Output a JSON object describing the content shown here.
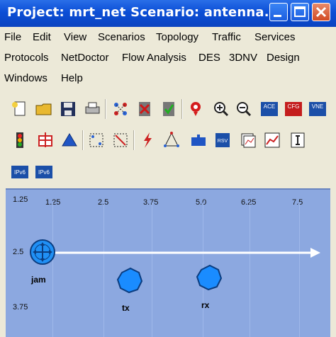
{
  "window": {
    "title": "Project: mrt_net Scenario: antenna..."
  },
  "menu": {
    "row1": [
      "File",
      "Edit",
      "View",
      "Scenarios",
      "Topology",
      "Traffic",
      "Services"
    ],
    "row2": [
      "Protocols",
      "NetDoctor",
      "Flow Analysis",
      "DES",
      "3DNV",
      "Design"
    ],
    "row3": [
      "Windows",
      "Help"
    ]
  },
  "toolbar": {
    "row1_icons": [
      "new-icon",
      "open-icon",
      "save-icon",
      "print-icon",
      "select-nodes-icon",
      "fail-icon",
      "recover-icon",
      "marker-icon",
      "zoom-in-icon",
      "zoom-out-icon",
      "ace-icon",
      "cfg-icon",
      "vne-icon"
    ],
    "row1_labels": {
      "ace": "ACE",
      "cfg": "CFG",
      "vne": "VNE"
    },
    "row2_icons": [
      "traffic-light-icon",
      "configure-icon",
      "triangle-icon",
      "grid-select-icon",
      "select-links-icon",
      "lightning-icon",
      "graph-icon",
      "puzzle-icon",
      "rsv-icon",
      "results-icon",
      "chart-icon",
      "text-icon"
    ],
    "row2_labels": {
      "rsv": "RSV"
    },
    "row3_icons": [
      "ipv6-icon",
      "ipv6-config-icon"
    ],
    "row3_labels": {
      "ipv6": "IPv6"
    }
  },
  "canvas": {
    "h_ruler": [
      "1.25",
      "2.5",
      "3.75",
      "5.0",
      "6.25",
      "7.5"
    ],
    "v_ruler": [
      "1.25",
      "2.5",
      "3.75"
    ],
    "nodes": [
      {
        "label": "jam"
      },
      {
        "label": "tx"
      },
      {
        "label": "rx"
      }
    ],
    "colors": {
      "background": "#8ca8e0",
      "node": "#1a8cff",
      "link": "#ffffff"
    }
  }
}
